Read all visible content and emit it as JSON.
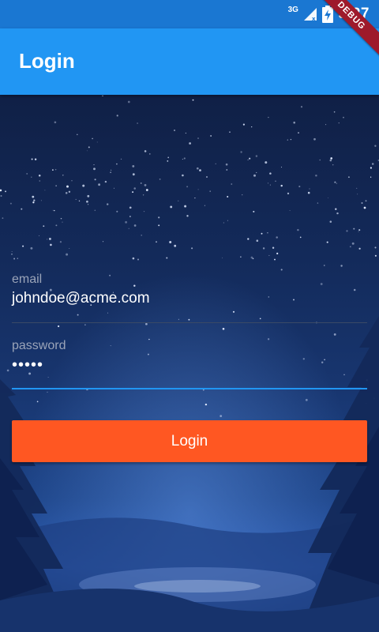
{
  "status_bar": {
    "network": "3G",
    "time": "9:27",
    "icons": [
      "signal-icon",
      "battery-charging-icon"
    ]
  },
  "debug_banner": "DEBUG",
  "app_bar": {
    "title": "Login"
  },
  "form": {
    "email": {
      "label": "email",
      "value": "johndoe@acme.com"
    },
    "password": {
      "label": "password",
      "value": "•••••"
    },
    "login_button": "Login"
  },
  "colors": {
    "primary": "#2196f3",
    "status_bar": "#1a77d2",
    "accent": "#ff5722",
    "debug_banner": "#9e1a2b"
  }
}
